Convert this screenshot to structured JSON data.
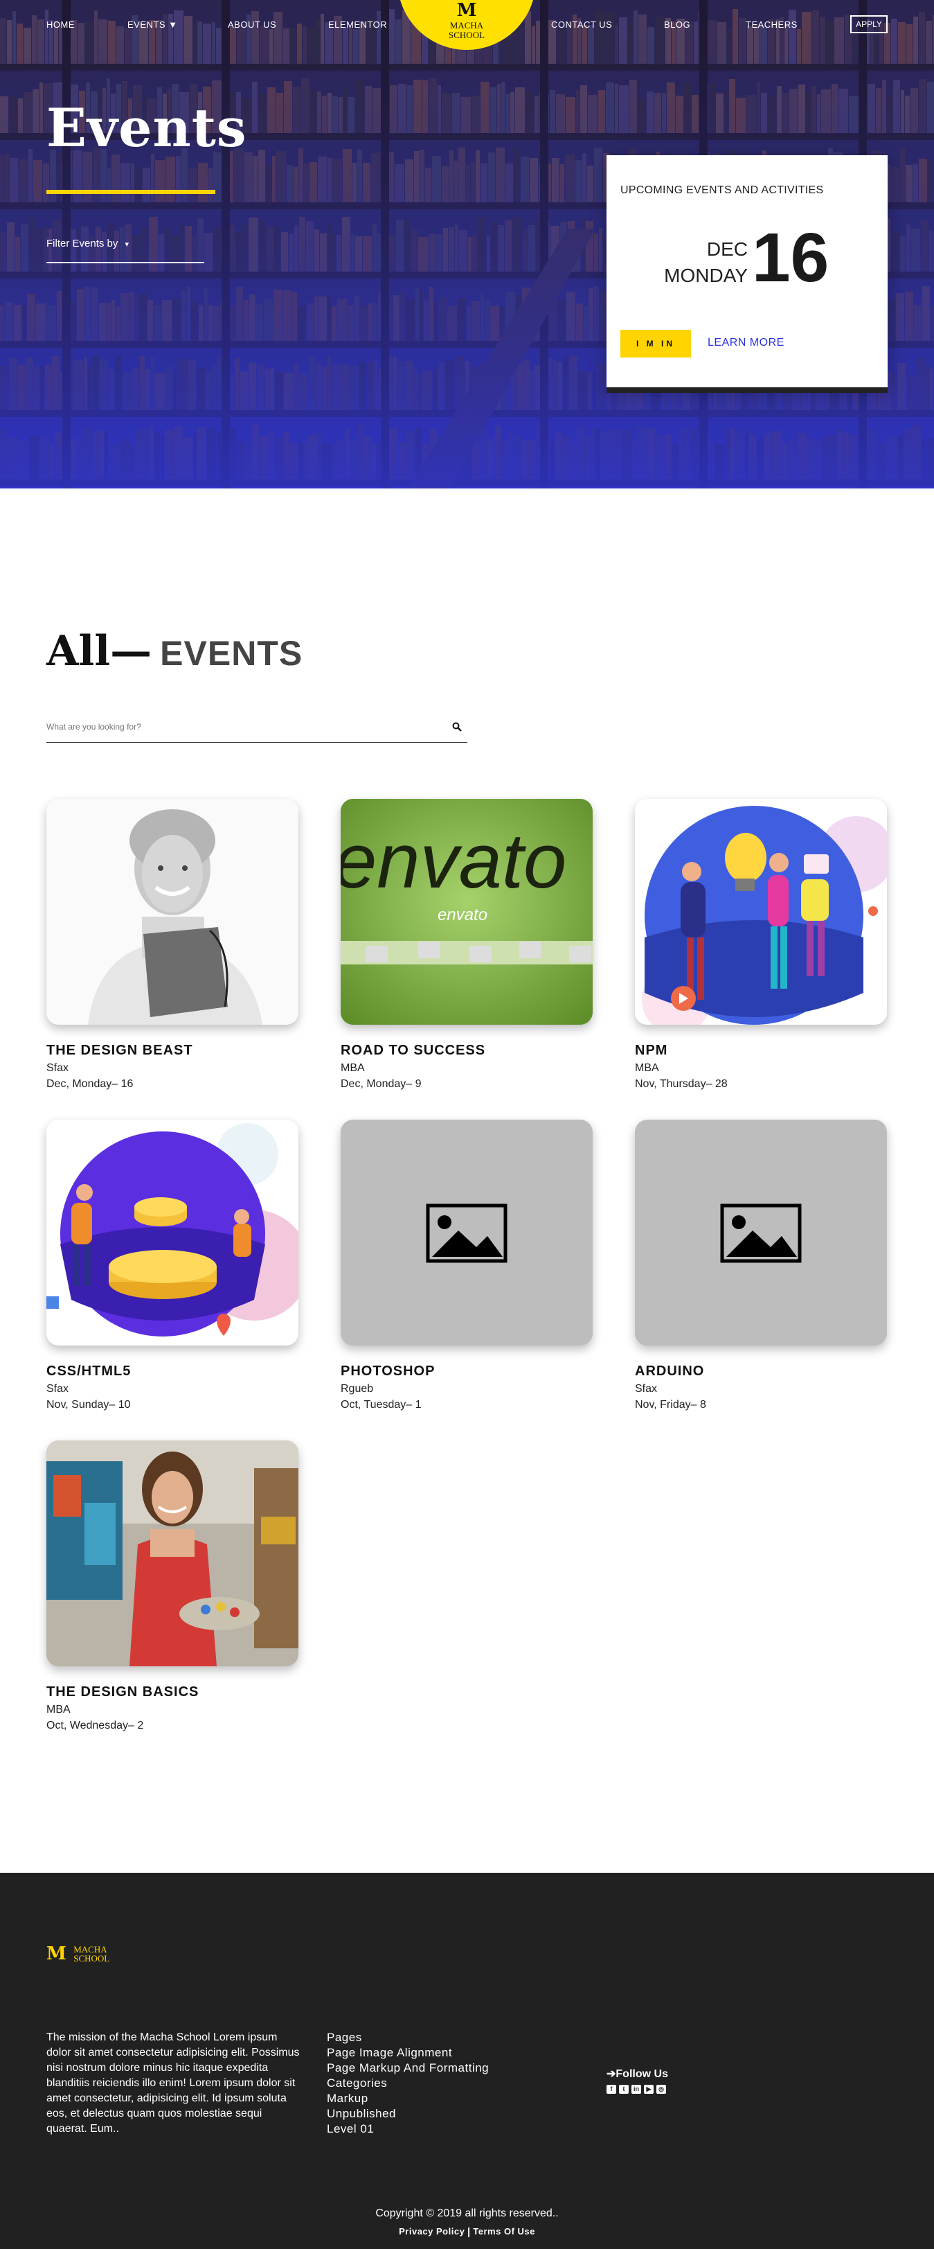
{
  "nav": {
    "items": [
      "HOME",
      "EVENTS ▼",
      "ABOUT US",
      "ELEMENTOR",
      "CONTACT US",
      "BLOG",
      "TEACHERS"
    ],
    "apply": "APPLY",
    "logo_letter": "M",
    "logo_line1": "MACHA",
    "logo_line2": "SCHOOL"
  },
  "hero": {
    "title": "Events",
    "filter_label": "Filter Events by",
    "filter_caret": "▾",
    "accent_color": "#ffd400"
  },
  "upcoming": {
    "heading": "UPCOMING EVENTS AND ACTIVITIES",
    "month": "DEC",
    "weekday": "MONDAY",
    "day": "16",
    "im_in": "I M IN",
    "learn_more": "LEARN MORE"
  },
  "all_events": {
    "title_big": "All—",
    "title_small": "EVENTS",
    "search_placeholder": "What are you looking for?"
  },
  "events": [
    {
      "title": "THE DESIGN BEAST",
      "location": "Sfax",
      "date": "Dec, Monday– 16",
      "image": "woman-portrait"
    },
    {
      "title": "ROAD TO SUCCESS",
      "location": "MBA",
      "date": "Dec, Monday– 9",
      "image": "envato-green"
    },
    {
      "title": "NPM",
      "location": "MBA",
      "date": "Nov, Thursday– 28",
      "image": "team-illustration"
    },
    {
      "title": "CSS/HTML5",
      "location": "Sfax",
      "date": "Nov, Sunday– 10",
      "image": "coins-illustration"
    },
    {
      "title": "PHOTOSHOP",
      "location": "Rgueb",
      "date": "Oct, Tuesday– 1",
      "image": "placeholder"
    },
    {
      "title": "ARDUINO",
      "location": "Sfax",
      "date": "Nov, Friday– 8",
      "image": "placeholder"
    },
    {
      "title": "THE DESIGN BASICS",
      "location": "MBA",
      "date": "Oct, Wednesday– 2",
      "image": "painter-photo"
    }
  ],
  "envato_text": "envato",
  "envato_small": "envato",
  "footer": {
    "logo_letter": "M",
    "logo_line1": "MACHA",
    "logo_line2": "SCHOOL",
    "mission": "The mission of the Macha School Lorem ipsum dolor sit amet consectetur adipisicing elit. Possimus nisi nostrum dolore minus hic itaque expedita blanditiis reiciendis illo enim! Lorem ipsum dolor sit amet consectetur, adipisicing elit. Id ipsum soluta eos, et delectus quam quos molestiae sequi quaerat. Eum..",
    "links": [
      "Pages",
      "Page Image Alignment",
      "Page Markup And Formatting",
      "Categories",
      "Markup",
      "Unpublished",
      "Level 01"
    ],
    "follow": "Follow Us",
    "social_icons": [
      "facebook-icon",
      "twitter-icon",
      "linkedin-icon",
      "youtube-icon",
      "instagram-icon"
    ],
    "copyright": "Copyright © 2019 all rights reserved..",
    "privacy": "Privacy Policy",
    "terms": "Terms Of Use"
  }
}
